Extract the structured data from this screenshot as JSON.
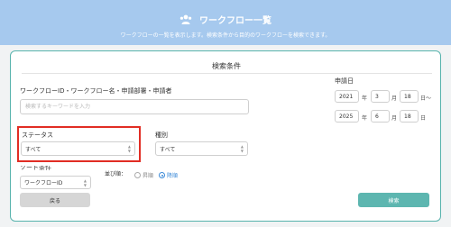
{
  "header": {
    "title": "ワークフロー一覧",
    "subtitle": "ワークフローの一覧を表示します。検索条件から目的のワークフローを検索できます。",
    "icon": "users-icon"
  },
  "panel": {
    "title": "検索条件",
    "keyword_label": "ワークフローID・ワークフロー名・申請部署・申請者",
    "keyword_placeholder": "検索するキーワードを入力",
    "keyword_value": "",
    "status_label": "ステータス",
    "status_value": "すべて",
    "type_label": "種別",
    "type_value": "すべて",
    "sort_label": "ソート条件",
    "sort_value": "ワークフローID",
    "order_label": "並び順：",
    "order_options": [
      "昇順",
      "降順"
    ],
    "order_selected": "降順",
    "date_label": "申請日",
    "date_from": {
      "year": "2021",
      "month": "3",
      "day": "18"
    },
    "date_to": {
      "year": "2025",
      "month": "6",
      "day": "18"
    },
    "units": {
      "year": "年",
      "month": "月",
      "day": "日",
      "range": "日〜"
    }
  },
  "buttons": {
    "back": "戻る",
    "search": "検索"
  },
  "colors": {
    "header": "#a6c9ee",
    "accent": "#5db6b0",
    "highlight": "#e12d24"
  }
}
